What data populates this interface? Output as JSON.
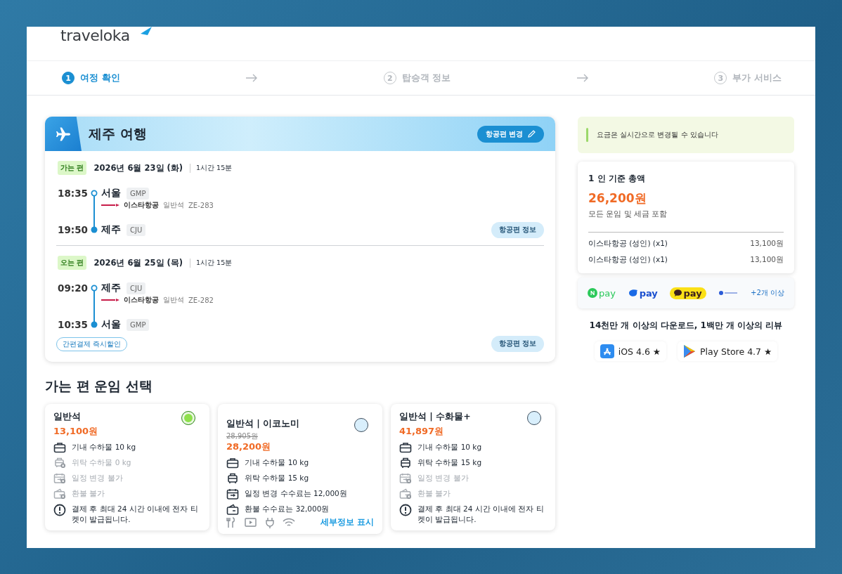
{
  "logo": "traveloka",
  "steps": [
    {
      "number": "1",
      "label": "여정 확인",
      "selected": true
    },
    {
      "number": "2",
      "label": "탑승객 정보",
      "selected": false
    },
    {
      "number": "3",
      "label": "부가 서비스",
      "selected": false
    }
  ],
  "trip": {
    "title": "제주 여행",
    "change_button": "항공편 변경",
    "legs": [
      {
        "tag": "가는 편",
        "date": "2026년 6월 23일 (화)",
        "duration": "1시간 15분",
        "departure": {
          "time": "18:35",
          "city": "서울",
          "code": "GMP"
        },
        "airline": "이스타항공",
        "cabin": "일반석",
        "flight": "ZE-283",
        "arrival": {
          "time": "19:50",
          "city": "제주",
          "code": "CJU"
        },
        "info_button": "항공편 정보"
      },
      {
        "tag": "오는 편",
        "date": "2026년 6월 25일 (목)",
        "duration": "1시간 15분",
        "departure": {
          "time": "09:20",
          "city": "제주",
          "code": "CJU"
        },
        "airline": "이스타항공",
        "cabin": "일반석",
        "flight": "ZE-282",
        "arrival": {
          "time": "10:35",
          "city": "서울",
          "code": "GMP"
        },
        "info_button": "항공편 정보"
      }
    ],
    "promo_badge": "간편결제 즉시할인"
  },
  "fares_title": "가는 편 운임 선택",
  "fares": [
    {
      "name": "일반석",
      "price": "13,100원",
      "selected": true,
      "features": [
        {
          "kind": "cabin",
          "text": "기내 수하물 10 kg",
          "available": true
        },
        {
          "kind": "checked",
          "text": "위탁 수하물 0 kg",
          "available": false
        },
        {
          "kind": "change",
          "text": "일정 변경 불가",
          "available": false
        },
        {
          "kind": "refund",
          "text": "환불 불가",
          "available": false
        },
        {
          "kind": "ticket",
          "text": "결제 후 최대 24 시간 이내에 전자 티켓이 발급됩니다.",
          "available": true
        }
      ]
    },
    {
      "name": "일반석 | 이코노미",
      "old_price": "28,905원",
      "price": "28,200원",
      "selected": false,
      "features": [
        {
          "kind": "cabin",
          "text": "기내 수하물 10 kg",
          "available": true
        },
        {
          "kind": "checked",
          "text": "위탁 수하물 15 kg",
          "available": true
        },
        {
          "kind": "change",
          "text": "일정 변경 수수료는 12,000원",
          "available": true
        },
        {
          "kind": "refund",
          "text": "환불 수수료는 32,000원",
          "available": true
        }
      ],
      "details_link": "세부정보 표시"
    },
    {
      "name": "일반석 | 수화물+",
      "price": "41,897원",
      "selected": false,
      "features": [
        {
          "kind": "cabin",
          "text": "기내 수하물 10 kg",
          "available": true
        },
        {
          "kind": "checked",
          "text": "위탁 수하물 15 kg",
          "available": true
        },
        {
          "kind": "change",
          "text": "일정 변경 불가",
          "available": false
        },
        {
          "kind": "refund",
          "text": "환불 불가",
          "available": false
        },
        {
          "kind": "ticket",
          "text": "결제 후 최대 24 시간 이내에 전자 티켓이 발급됩니다.",
          "available": true
        }
      ]
    }
  ],
  "notice": "요금은 실시간으로 변경될 수 있습니다",
  "summary": {
    "title": "1 인 기준 총액",
    "total": "26,200원",
    "note": "모든 운임 및 세금 포함",
    "items": [
      {
        "label": "이스타항공 (성인) (x1)",
        "amount": "13,100원"
      },
      {
        "label": "이스타항공 (성인) (x1)",
        "amount": "13,100원"
      }
    ]
  },
  "payments": [
    {
      "kind": "npay",
      "text": "pay"
    },
    {
      "kind": "toss",
      "text": "pay"
    },
    {
      "kind": "kakao",
      "text": "pay"
    },
    {
      "kind": "card"
    },
    {
      "kind": "more",
      "text": "+2개 이상"
    }
  ],
  "downloads": "14천만 개 이상의 다운로드, 1백만 개 이상의 리뷰",
  "stores": [
    {
      "kind": "ios",
      "text": "iOS 4.6 ★"
    },
    {
      "kind": "play",
      "text": "Play Store 4.7 ★"
    }
  ]
}
